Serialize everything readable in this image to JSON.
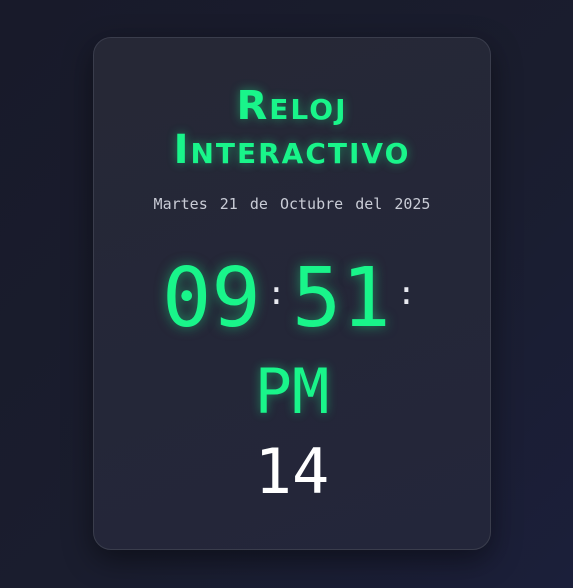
{
  "clock": {
    "title_line1": "Reloj",
    "title_line2": "Interactivo",
    "date": "Martes 21 de Octubre del 2025",
    "hours": "09",
    "separator1": ":",
    "minutes": "51",
    "separator2": ":",
    "period": "PM",
    "seconds": "14"
  },
  "colors": {
    "accent": "#19f58a",
    "background": "#1a1d2e",
    "card": "#262836",
    "text": "#c9ccd6"
  }
}
